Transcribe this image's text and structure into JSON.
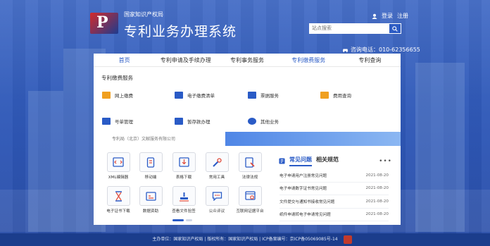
{
  "header": {
    "org_name": "国家知识产权局",
    "system_title": "专利业务办理系统",
    "login_label": "登录",
    "register_label": "注册",
    "search_placeholder": "站点搜索",
    "hotline": "咨询电话：010-62356655"
  },
  "nav": {
    "items": [
      {
        "label": "首页"
      },
      {
        "label": "专利申请及手续办理"
      },
      {
        "label": "专利事务服务"
      },
      {
        "label": "专利缴费服务"
      },
      {
        "label": "专利查询"
      }
    ]
  },
  "dropdown": {
    "title": "专利缴费服务",
    "items": [
      {
        "label": "网上缴费",
        "icon": "card-icon"
      },
      {
        "label": "电子缴费清单",
        "icon": "list-icon"
      },
      {
        "label": "票据服务",
        "icon": "receipt-icon"
      },
      {
        "label": "费用查询",
        "icon": "fee-search-icon"
      },
      {
        "label": "号单管理",
        "icon": "id-card-icon"
      },
      {
        "label": "暂存款办理",
        "icon": "deposit-icon"
      },
      {
        "label": "其他业务",
        "icon": "user-icon"
      }
    ]
  },
  "strip": {
    "text": "专利局（北京）文献服务有限公司"
  },
  "tiles": [
    {
      "label": "XML编辑器",
      "icon": "xml-icon"
    },
    {
      "label": "移动端",
      "icon": "mobile-icon"
    },
    {
      "label": "表格下载",
      "icon": "download-icon"
    },
    {
      "label": "常用工具",
      "icon": "tools-icon"
    },
    {
      "label": "法律法规",
      "icon": "law-icon"
    },
    {
      "label": "电子证书下载",
      "icon": "certificate-icon"
    },
    {
      "label": "数据资助",
      "icon": "calendar-icon"
    },
    {
      "label": "查看文件验签",
      "icon": "stamp-icon"
    },
    {
      "label": "公众评议",
      "icon": "comment-icon"
    },
    {
      "label": "互联网证据平台",
      "icon": "browser-icon"
    }
  ],
  "faq": {
    "tab_active": "常见问题",
    "tab_other": "相关规范",
    "more": "•••",
    "rows": [
      {
        "title": "电子申请用户注册常见问题",
        "date": "2021-08-20"
      },
      {
        "title": "电子申请数字证书常见问题",
        "date": "2021-08-20"
      },
      {
        "title": "文件提交与通知书接收常见问题",
        "date": "2021-08-20"
      },
      {
        "title": "纸件申请转电子申请常见问题",
        "date": "2021-08-20"
      }
    ]
  },
  "footer": {
    "text": "主办单位：国家知识产权局 | 版权所有：国家知识产权局 | ICP备案编号：京ICP备05069085号-14"
  },
  "colors": {
    "accent": "#2a5bc6",
    "background": "#3d67c4",
    "footer": "#1b3d8c"
  }
}
